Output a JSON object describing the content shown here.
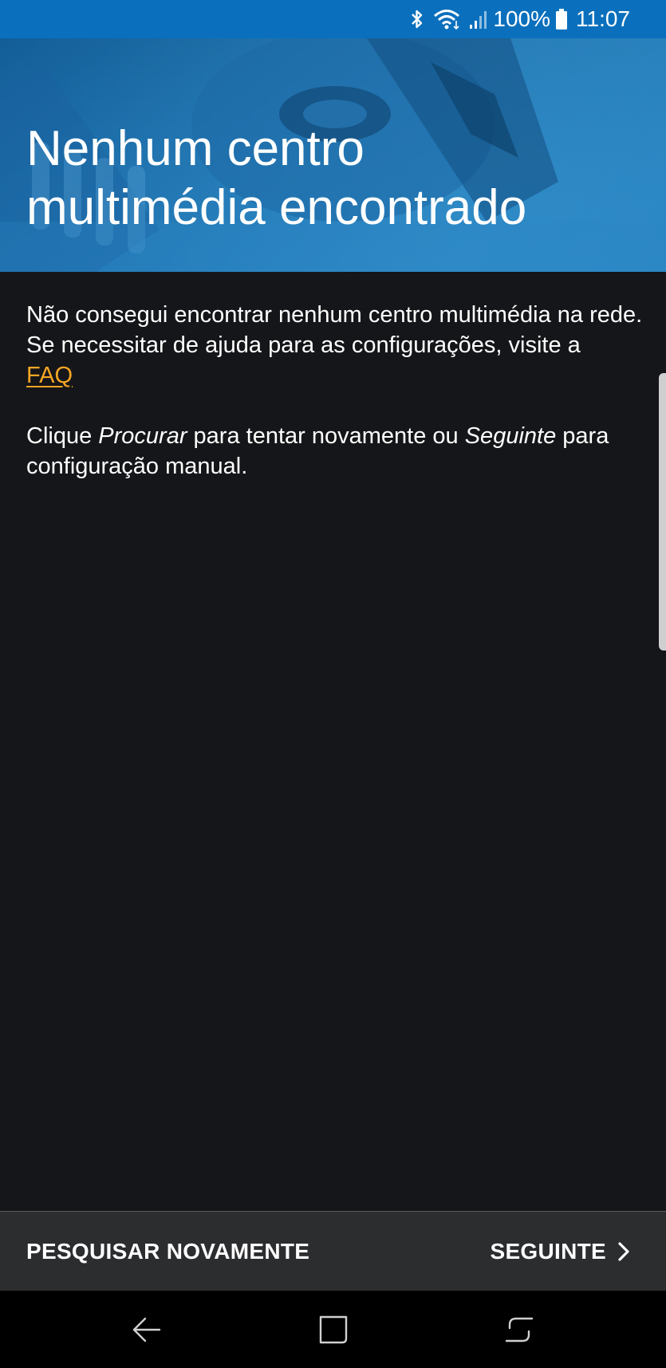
{
  "status_bar": {
    "battery_text": "100%",
    "time": "11:07",
    "icons": [
      "bluetooth-icon",
      "wifi-icon",
      "signal-icon",
      "battery-icon"
    ]
  },
  "header": {
    "title": "Nenhum centro\nmultimédia encontrado"
  },
  "content": {
    "line1": "Não consegui encontrar nenhum centro multimédia na rede.",
    "line2": "Se necessitar de ajuda para as configurações, visite a",
    "faq_link": "FAQ",
    "line3_prefix": "Clique ",
    "line3_em1": "Procurar",
    "line3_mid": " para tentar novamente ou ",
    "line3_em2": "Seguinte",
    "line3_suffix": " para configuração manual."
  },
  "actions": {
    "search_again": "PESQUISAR NOVAMENTE",
    "next": "SEGUINTE"
  },
  "nav_bar": {
    "icons": [
      "back-icon",
      "home-icon",
      "recent-apps-icon"
    ]
  },
  "colors": {
    "status_bar": "#0a70bd",
    "background": "#151619",
    "link": "#f5a623",
    "action_bar": "#2c2d2f"
  }
}
